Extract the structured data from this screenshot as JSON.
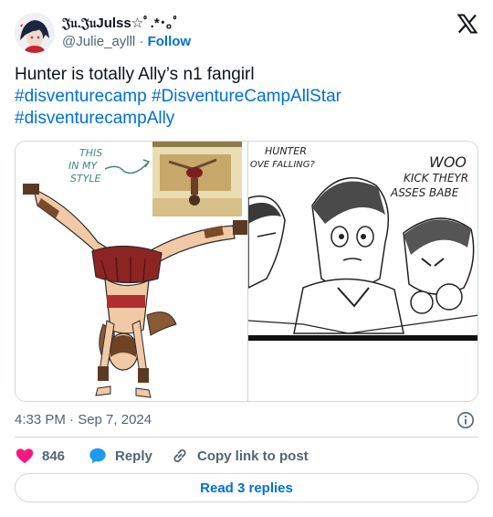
{
  "author": {
    "display_name": "𝔍𝔲.𝔍𝔲Julss☆ﾟ.*･｡ﾟ",
    "handle": "@Julie_aylll",
    "separator": "·",
    "follow_label": "Follow"
  },
  "tweet": {
    "text": "Hunter is totally Ally’s n1 fangirl",
    "hashtags": [
      "#disventurecamp #DisventureCampAllStar",
      "#disventurecampAlly"
    ]
  },
  "media": {
    "left_annotation": "THIS IN MY STYLE",
    "right_caption_1": "HUNTER OVE FALLING?",
    "right_caption_2": "WOO KICK THEYR ASSES BABE"
  },
  "meta": {
    "timestamp": "4:33 PM · Sep 7, 2024"
  },
  "actions": {
    "like_count": "846",
    "reply_label": "Reply",
    "copy_label": "Copy link to post"
  },
  "replies_button": "Read 3 replies",
  "colors": {
    "link": "#006fd6",
    "heart": "#f91880",
    "reply_bubble": "#1d9bf0",
    "muted": "#536471"
  },
  "icons": [
    "x-logo-icon",
    "info-icon",
    "heart-icon",
    "reply-bubble-icon",
    "link-icon"
  ]
}
